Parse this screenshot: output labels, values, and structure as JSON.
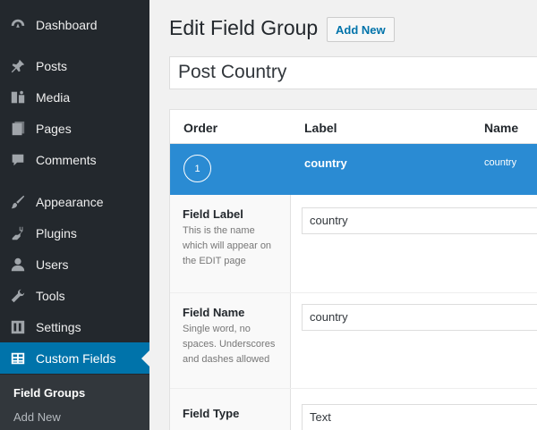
{
  "sidebar": {
    "items": [
      {
        "label": "Dashboard",
        "icon": "dashboard-icon"
      },
      {
        "label": "Posts",
        "icon": "pin-icon"
      },
      {
        "label": "Media",
        "icon": "media-icon"
      },
      {
        "label": "Pages",
        "icon": "pages-icon"
      },
      {
        "label": "Comments",
        "icon": "comment-icon"
      },
      {
        "label": "Appearance",
        "icon": "brush-icon"
      },
      {
        "label": "Plugins",
        "icon": "plug-icon"
      },
      {
        "label": "Users",
        "icon": "user-icon"
      },
      {
        "label": "Tools",
        "icon": "wrench-icon"
      },
      {
        "label": "Settings",
        "icon": "settings-icon"
      },
      {
        "label": "Custom Fields",
        "icon": "table-icon",
        "active": true
      }
    ],
    "submenu": [
      "Field Groups",
      "Add New"
    ]
  },
  "header": {
    "title": "Edit Field Group",
    "add_new": "Add New"
  },
  "group_title": "Post Country",
  "columns": {
    "order": "Order",
    "label": "Label",
    "name": "Name"
  },
  "field": {
    "order": "1",
    "label": "country",
    "name": "country"
  },
  "settings": [
    {
      "label": "Field Label",
      "desc": "This is the name which will appear on the EDIT page",
      "value": "country"
    },
    {
      "label": "Field Name",
      "desc": "Single word, no spaces. Underscores and dashes allowed",
      "value": "country"
    },
    {
      "label": "Field Type",
      "desc": "",
      "value": "Text"
    }
  ],
  "colors": {
    "sidebar": "#23282d",
    "accent": "#0073aa",
    "row": "#2a8bd3"
  }
}
